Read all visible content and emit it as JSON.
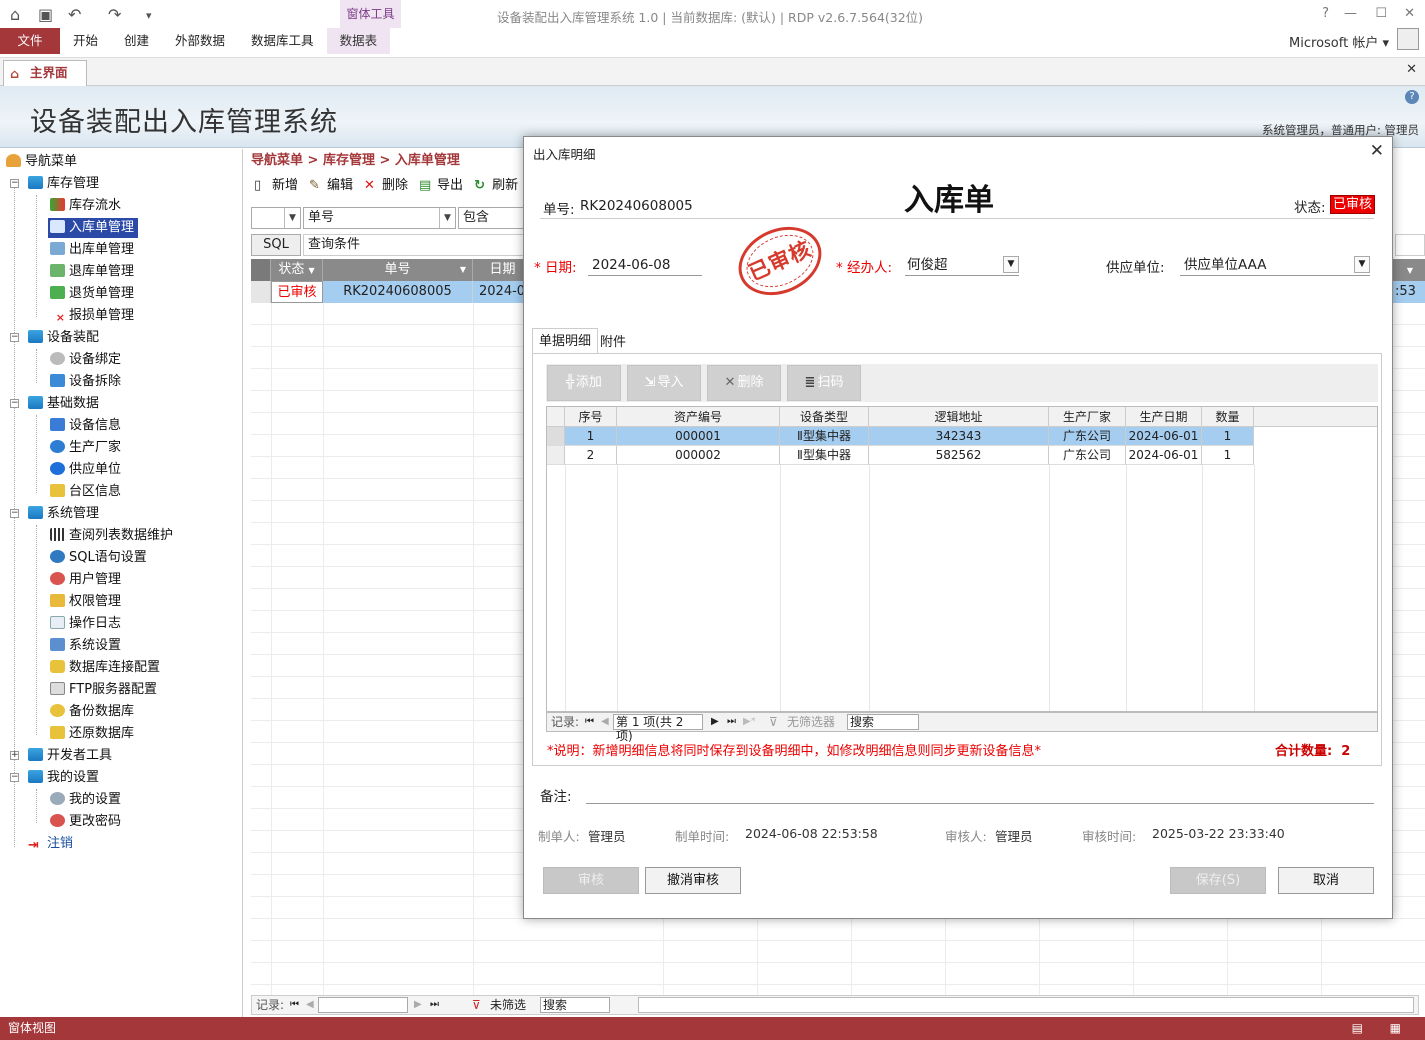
{
  "window": {
    "title": "设备装配出入库管理系统 1.0 | 当前数据库: (默认) | RDP v2.6.7.564(32位)",
    "context_group": "窗体工具",
    "account": "Microsoft 帐户",
    "ribbon_tabs": [
      "文件",
      "开始",
      "创建",
      "外部数据",
      "数据库工具",
      "数据表"
    ]
  },
  "doc_tab": "主界面",
  "banner": {
    "title": "设备装配出入库管理系统",
    "user": "系统管理员，普通用户: 管理员"
  },
  "nav": {
    "root": "导航菜单",
    "groups": [
      {
        "label": "库存管理",
        "items": [
          "库存流水",
          "入库单管理",
          "出库单管理",
          "退库单管理",
          "退货单管理",
          "报损单管理"
        ]
      },
      {
        "label": "设备装配",
        "items": [
          "设备绑定",
          "设备拆除"
        ]
      },
      {
        "label": "基础数据",
        "items": [
          "设备信息",
          "生产厂家",
          "供应单位",
          "台区信息"
        ]
      },
      {
        "label": "系统管理",
        "items": [
          "查阅列表数据维护",
          "SQL语句设置",
          "用户管理",
          "权限管理",
          "操作日志",
          "系统设置",
          "数据库连接配置",
          "FTP服务器配置",
          "备份数据库",
          "还原数据库"
        ]
      },
      {
        "label": "开发者工具",
        "items": []
      },
      {
        "label": "我的设置",
        "items": [
          "我的设置",
          "更改密码"
        ]
      }
    ],
    "logout": "注销",
    "selected": "入库单管理"
  },
  "main": {
    "breadcrumb": "导航菜单 > 库存管理 > 入库单管理",
    "toolbar": [
      "新增",
      "编辑",
      "删除",
      "导出",
      "刷新"
    ],
    "filter_field": "单号",
    "filter_op": "包含",
    "sql_button": "SQL",
    "sql_placeholder": "查询条件",
    "columns": [
      "状态",
      "单号",
      "日期"
    ],
    "rows": [
      {
        "status": "已审核",
        "no": "RK20240608005",
        "date": "2024-0"
      }
    ],
    "right_cell": ":53",
    "nav_label": "记录:",
    "nav_filter": "未筛选",
    "nav_search": "搜索"
  },
  "dialog": {
    "title": "出入库明细",
    "heading": "入库单",
    "bill_label": "单号:",
    "bill_no": "RK20240608005",
    "status_label": "状态:",
    "status": "已审核",
    "date_label": "日期:",
    "date": "2024-06-08",
    "stamp": "已审核",
    "handler_label": "经办人:",
    "handler": "何俊超",
    "supplier_label": "供应单位:",
    "supplier": "供应单位AAA",
    "tabs": [
      "单据明细",
      "附件"
    ],
    "buttons": [
      "添加",
      "导入",
      "删除",
      "扫码"
    ],
    "columns": [
      "序号",
      "资产编号",
      "设备类型",
      "逻辑地址",
      "生产厂家",
      "生产日期",
      "数量"
    ],
    "rows": [
      [
        "1",
        "000001",
        "Ⅱ型集中器",
        "342343",
        "广东公司",
        "2024-06-01",
        "1"
      ],
      [
        "2",
        "000002",
        "Ⅱ型集中器",
        "582562",
        "广东公司",
        "2024-06-01",
        "1"
      ]
    ],
    "nav_label": "记录:",
    "nav_pos": "第 1 项(共 2 项)",
    "nav_filter": "无筛选器",
    "nav_search": "搜索",
    "note": "*说明：新增明细信息将同时保存到设备明细中，如修改明细信息则同步更新设备信息*",
    "total_label": "合计数量:",
    "total": "2",
    "remark_label": "备注:",
    "creator_label": "制单人:",
    "creator": "管理员",
    "created_label": "制单时间:",
    "created": "2024-06-08 22:53:58",
    "auditor_label": "审核人:",
    "auditor": "管理员",
    "audited_label": "审核时间:",
    "audited": "2025-03-22 23:33:40",
    "btn_audit": "审核",
    "btn_unaudit": "撤消审核",
    "btn_save": "保存(S)",
    "btn_cancel": "取消"
  },
  "statusbar": "窗体视图",
  "colors": {
    "accent": "#a4373a",
    "selection": "#a5cdf0",
    "nav_selected": "#2b4aa8",
    "alert": "#e00000"
  }
}
